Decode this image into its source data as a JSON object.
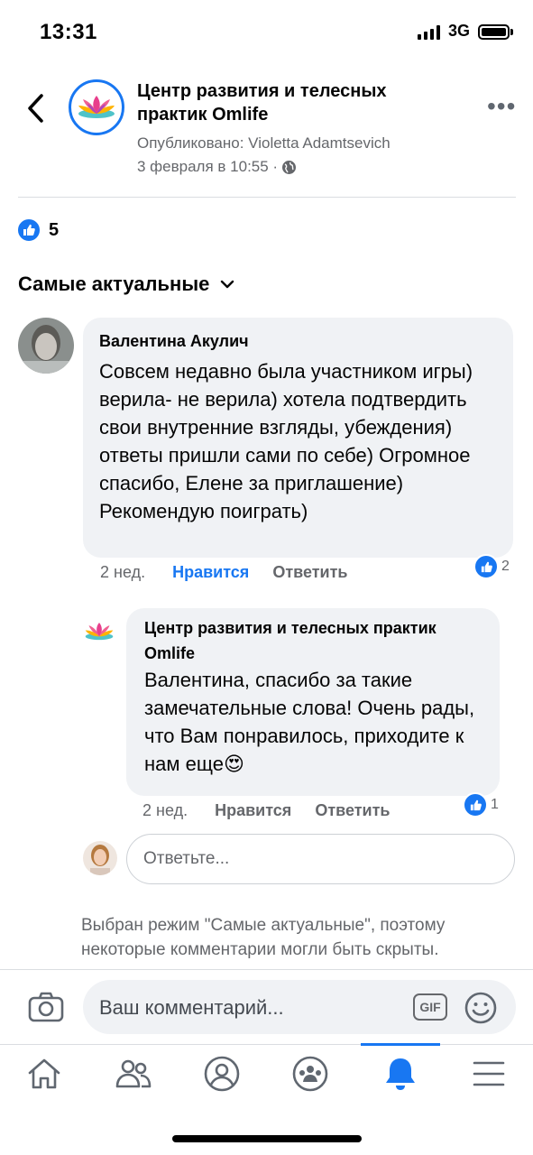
{
  "status_bar": {
    "time": "13:31",
    "network": "3G"
  },
  "header": {
    "page_name": "Центр развития и телесных практик Omlife",
    "published_by": "Опубликовано: Violetta Adamtsevich",
    "date": "3 февраля в 10:55 ·",
    "more": "•••"
  },
  "post": {
    "likes_count": "5"
  },
  "sort": {
    "label": "Самые актуальные"
  },
  "comments": [
    {
      "author": "Валентина Акулич",
      "text": "Совсем недавно была участником игры) верила- не верила) хотела подтвердить свои внутренние взгляды, убеждения) ответы пришли сами по себе) Огромное спасибо, Елене за приглашение) Рекомендую поиграть)",
      "age": "2 нед.",
      "like_label": "Нравится",
      "reply_label": "Ответить",
      "reactions": "2",
      "liked": true
    }
  ],
  "replies": [
    {
      "author": "Центр развития и телесных практик Omlife",
      "text": "Валентина, спасибо за такие замечательные слова! Очень рады, что Вам понравилось, приходите к нам еще",
      "emoji": "😍",
      "age": "2 нед.",
      "like_label": "Нравится",
      "reply_label": "Ответить",
      "reactions": "1"
    }
  ],
  "reply_input": {
    "placeholder": "Ответьте..."
  },
  "notice": "Выбран режим \"Самые актуальные\", поэтому некоторые комментарии могли быть скрыты.",
  "composer": {
    "placeholder": "Ваш комментарий...",
    "gif_label": "GIF"
  },
  "tabs": [
    {
      "name": "home",
      "icon": "home-icon"
    },
    {
      "name": "friends",
      "icon": "friends-icon"
    },
    {
      "name": "profile",
      "icon": "profile-icon"
    },
    {
      "name": "groups",
      "icon": "groups-icon"
    },
    {
      "name": "notifications",
      "icon": "bell-icon",
      "active": true
    },
    {
      "name": "menu",
      "icon": "menu-icon"
    }
  ],
  "colors": {
    "accent": "#1877f2",
    "bubble": "#f0f2f5",
    "secondary_text": "#65676b"
  }
}
